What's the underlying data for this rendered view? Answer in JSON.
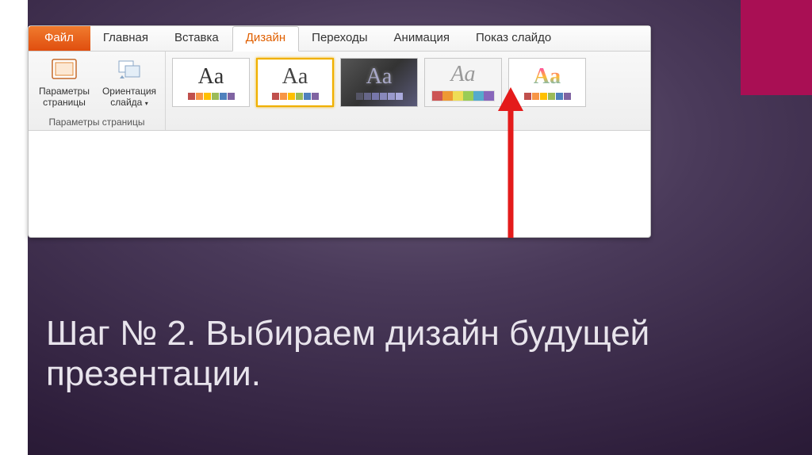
{
  "tabs": {
    "file": "Файл",
    "home": "Главная",
    "insert": "Вставка",
    "design": "Дизайн",
    "transitions": "Переходы",
    "animation": "Анимация",
    "slideshow": "Показ слайдо"
  },
  "ribbon": {
    "page_params_btn": "Параметры страницы",
    "slide_orientation_btn": "Ориентация слайда",
    "group_page_setup": "Параметры страницы",
    "theme_label": "Aa"
  },
  "caption": {
    "line1": "Шаг № 2. Выбираем дизайн будущей",
    "line2": "презентации."
  }
}
